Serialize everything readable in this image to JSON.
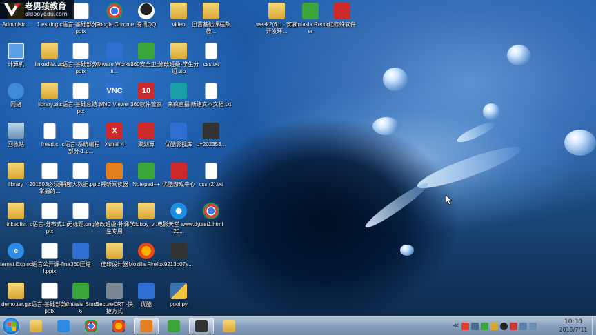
{
  "watermark": {
    "title": "老男孩教育",
    "url": "oldboyedu.com"
  },
  "desktop": {
    "icons": [
      {
        "label": "Administr...",
        "glyph": "",
        "type": "g-folder"
      },
      {
        "label": "计算机",
        "glyph": "",
        "type": "g-pc"
      },
      {
        "label": "网络",
        "glyph": "",
        "type": "g-net"
      },
      {
        "label": "回收站",
        "glyph": "",
        "type": "g-recycle"
      },
      {
        "label": "library",
        "glyph": "",
        "type": "g-folder"
      },
      {
        "label": "linkedlist",
        "glyph": "",
        "type": "g-folder"
      },
      {
        "label": "Internet Explorer",
        "glyph": "e",
        "type": "g-ie"
      },
      {
        "label": "demo.tar.gz",
        "glyph": "",
        "type": "g-folder"
      },
      {
        "label": "1.estring.c",
        "glyph": "",
        "type": "g-doc"
      },
      {
        "label": "linkedlist.zip",
        "glyph": "",
        "type": "g-folder"
      },
      {
        "label": "library.zip",
        "glyph": "",
        "type": "g-folder"
      },
      {
        "label": "fread.c",
        "glyph": "",
        "type": "g-doc"
      },
      {
        "label": "201603必须熟练掌握的...",
        "glyph": "",
        "type": "g-pptx"
      },
      {
        "label": "c语言-分布式1.pptx",
        "glyph": "",
        "type": "g-pptx"
      },
      {
        "label": "c语言公开课-final.pptx",
        "glyph": "",
        "type": "g-pptx"
      },
      {
        "label": "c语言-基础部分2.pptx",
        "glyph": "",
        "type": "g-pptx"
      },
      {
        "label": "c语言-基础部分3.pptx",
        "glyph": "",
        "type": "g-pptx"
      },
      {
        "label": "c语言-基础部分4.pptx",
        "glyph": "",
        "type": "g-pptx"
      },
      {
        "label": "c语言-基础总结.pptx",
        "glyph": "",
        "type": "g-pptx"
      },
      {
        "label": "c语言-系统编程部分-1.p...",
        "glyph": "",
        "type": "g-pptx"
      },
      {
        "label": "解密大数据.pptx",
        "glyph": "",
        "type": "g-pptx"
      },
      {
        "label": "无标题.png",
        "glyph": "",
        "type": "g-pptx"
      },
      {
        "label": "360压缩",
        "glyph": "",
        "type": "g-blue"
      },
      {
        "label": "Camtasia Studio 6",
        "glyph": "",
        "type": "g-green"
      },
      {
        "label": "Google Chrome",
        "glyph": "",
        "type": "g-chrome"
      },
      {
        "label": "VMware Workstati...",
        "glyph": "",
        "type": "g-blue"
      },
      {
        "label": "VNC Viewer",
        "glyph": "VNC",
        "type": "g-blue"
      },
      {
        "label": "Xshell 4",
        "glyph": "X",
        "type": "g-red"
      },
      {
        "label": "福昕阅读器",
        "glyph": "",
        "type": "g-orange"
      },
      {
        "label": "修改班级-补课学生专用",
        "glyph": "",
        "type": "g-folder"
      },
      {
        "label": "佳印设计器",
        "glyph": "",
        "type": "g-folder"
      },
      {
        "label": "SecureCRT -快捷方式",
        "glyph": "",
        "type": "g-gray"
      },
      {
        "label": "腾讯QQ",
        "glyph": "",
        "type": "g-qq"
      },
      {
        "label": "360安全卫士",
        "glyph": "",
        "type": "g-green"
      },
      {
        "label": "360软件管家",
        "glyph": "10",
        "type": "g-red"
      },
      {
        "label": "聚划算",
        "glyph": "",
        "type": "g-red"
      },
      {
        "label": "Notepad++",
        "glyph": "",
        "type": "g-green"
      },
      {
        "label": "oldboy_vi...",
        "glyph": "",
        "type": "g-folder"
      },
      {
        "label": "Mozilla Firefox",
        "glyph": "",
        "type": "g-firefox"
      },
      {
        "label": "优酷",
        "glyph": "",
        "type": "g-blue"
      },
      {
        "label": "video",
        "glyph": "",
        "type": "g-folder"
      },
      {
        "label": "修改班级-学生分组.zip",
        "glyph": "",
        "type": "g-folder"
      },
      {
        "label": "来疯直播",
        "glyph": "",
        "type": "g-teal"
      },
      {
        "label": "优酷影视库",
        "glyph": "",
        "type": "g-blue"
      },
      {
        "label": "优酷游戏中心",
        "glyph": "",
        "type": "g-red"
      },
      {
        "label": "电影天堂 www.dy20...",
        "glyph": "",
        "type": "g-video"
      },
      {
        "label": "9213b07e...",
        "glyph": "",
        "type": "g-dark"
      },
      {
        "label": "pool.py",
        "glyph": "",
        "type": "g-py"
      },
      {
        "label": "迅雷基础课程数教...",
        "glyph": "",
        "type": "g-folder"
      },
      {
        "label": "css.txt",
        "glyph": "",
        "type": "g-doc"
      },
      {
        "label": "新建文本文档.txt",
        "glyph": "",
        "type": "g-doc"
      },
      {
        "label": "u=202353...",
        "glyph": "",
        "type": "g-dark"
      },
      {
        "label": "css (2).txt",
        "glyph": "",
        "type": "g-doc"
      },
      {
        "label": "test1.html",
        "glyph": "",
        "type": "g-chrome"
      },
      {
        "label": "week2(6.p...安装开发环...",
        "glyph": "",
        "type": "g-folder"
      },
      {
        "label": "Camtasia Recorder",
        "glyph": "",
        "type": "g-green"
      },
      {
        "label": "红蜘蛛软件",
        "glyph": "",
        "type": "g-red"
      }
    ]
  },
  "taskbar": {
    "apps": [
      {
        "name": "taskbar-app-explorer",
        "type": "g-folder",
        "active": false
      },
      {
        "name": "taskbar-app-ie",
        "type": "g-ie",
        "active": false
      },
      {
        "name": "taskbar-app-chrome",
        "type": "g-chrome",
        "active": false
      },
      {
        "name": "taskbar-app-firefox",
        "type": "g-firefox",
        "active": false
      },
      {
        "name": "taskbar-app-qq-user",
        "type": "g-orange",
        "active": true
      },
      {
        "name": "taskbar-app-camtasia",
        "type": "g-green",
        "active": false
      },
      {
        "name": "taskbar-app-pycharm",
        "type": "g-dark",
        "active": true
      },
      {
        "name": "taskbar-app-folder",
        "type": "g-folder",
        "active": false
      }
    ],
    "tray_arrow": "≪",
    "clock": {
      "time": "10:38",
      "date": "2016/7/11"
    }
  }
}
